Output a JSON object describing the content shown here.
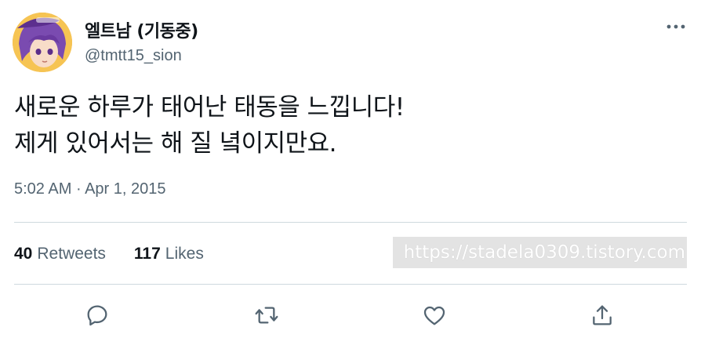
{
  "author": {
    "display_name": "엘트남 (기동중)",
    "handle": "@tmtt15_sion",
    "avatar_icon": "anime-avatar-icon"
  },
  "tweet": {
    "lines": [
      "새로운 하루가 태어난 태동을 느낍니다!",
      "제게 있어서는 해 질 녘이지만요."
    ],
    "time": "5:02 AM",
    "separator": "·",
    "date": "Apr 1, 2015"
  },
  "stats": {
    "retweets_count": "40",
    "retweets_label": "Retweets",
    "likes_count": "117",
    "likes_label": "Likes"
  },
  "watermark": "https://stadela0309.tistory.com",
  "actions": [
    {
      "name": "reply",
      "icon": "reply-icon"
    },
    {
      "name": "retweet",
      "icon": "retweet-icon"
    },
    {
      "name": "like",
      "icon": "heart-icon"
    },
    {
      "name": "share",
      "icon": "share-icon"
    }
  ],
  "colors": {
    "text_primary": "#0f1419",
    "text_secondary": "#536471",
    "divider": "#cfd9de"
  }
}
